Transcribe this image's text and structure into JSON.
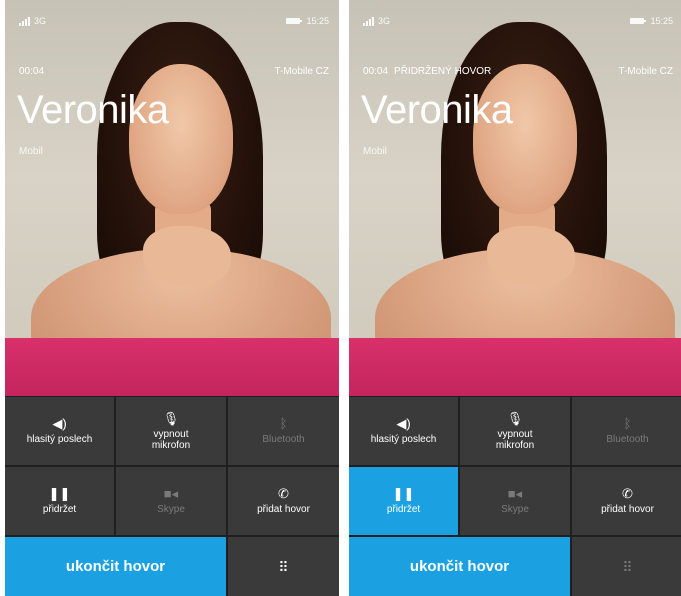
{
  "colors": {
    "accent": "#1ba1e2",
    "tile": "#3a3a3a",
    "tile_disabled_text": "#7a7a7a"
  },
  "screens": [
    {
      "status": {
        "network": "3G",
        "time": "15:25"
      },
      "call": {
        "duration": "00:04",
        "hold_status": "",
        "carrier": "T-Mobile CZ",
        "contact_name": "Veronika",
        "number_type": "Mobil"
      },
      "buttons": {
        "speaker": {
          "label": "hlasitý poslech",
          "icon": "speaker-icon"
        },
        "mute": {
          "label": "vypnout mikrofon",
          "icon": "mic-off-icon"
        },
        "bluetooth": {
          "label": "Bluetooth",
          "icon": "bluetooth-icon"
        },
        "hold": {
          "label": "přidržet",
          "icon": "pause-icon"
        },
        "skype": {
          "label": "Skype",
          "icon": "video-camera-icon"
        },
        "add_call": {
          "label": "přidat hovor",
          "icon": "add-call-icon"
        },
        "end_call": {
          "label": "ukončit hovor"
        },
        "keypad": {
          "icon": "keypad-icon"
        }
      }
    },
    {
      "status": {
        "network": "3G",
        "time": "15:25"
      },
      "call": {
        "duration": "00:04",
        "hold_status": "PŘIDRŽENÝ HOVOR",
        "carrier": "T-Mobile CZ",
        "contact_name": "Veronika",
        "number_type": "Mobil"
      },
      "buttons": {
        "speaker": {
          "label": "hlasitý poslech",
          "icon": "speaker-icon"
        },
        "mute": {
          "label": "vypnout mikrofon",
          "icon": "mic-off-icon"
        },
        "bluetooth": {
          "label": "Bluetooth",
          "icon": "bluetooth-icon"
        },
        "hold": {
          "label": "přidržet",
          "icon": "pause-icon",
          "active": true
        },
        "skype": {
          "label": "Skype",
          "icon": "video-camera-icon"
        },
        "add_call": {
          "label": "přidat hovor",
          "icon": "add-call-icon"
        },
        "end_call": {
          "label": "ukončit hovor"
        },
        "keypad": {
          "icon": "keypad-icon"
        }
      }
    }
  ]
}
